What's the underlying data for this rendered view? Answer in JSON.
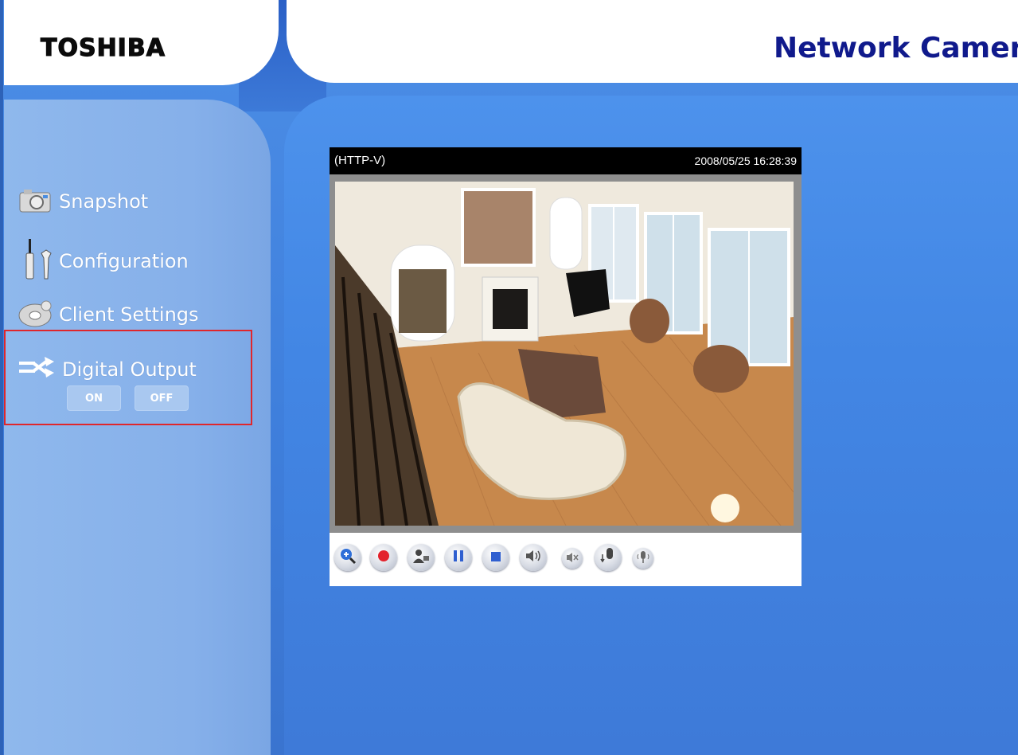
{
  "header": {
    "logo": "TOSHIBA",
    "title": "Network Camera"
  },
  "sidebar": {
    "items": [
      {
        "label": "Snapshot",
        "icon": "camera-icon"
      },
      {
        "label": "Configuration",
        "icon": "tools-icon"
      },
      {
        "label": "Client Settings",
        "icon": "disc-icon"
      },
      {
        "label": "Digital Output",
        "icon": "switch-arrows-icon"
      }
    ],
    "digital_output": {
      "on_label": "ON",
      "off_label": "OFF"
    }
  },
  "viewer": {
    "mode": "(HTTP-V)",
    "timestamp": "2008/05/25 16:28:39",
    "controls": [
      {
        "icon": "zoom-in-icon"
      },
      {
        "icon": "record-icon"
      },
      {
        "icon": "snapshot-person-icon"
      },
      {
        "icon": "pause-icon"
      },
      {
        "icon": "stop-icon"
      },
      {
        "icon": "speaker-icon"
      },
      {
        "icon": "mute-icon"
      },
      {
        "icon": "talk-icon"
      },
      {
        "icon": "microphone-icon"
      }
    ]
  },
  "colors": {
    "title": "#101a8c",
    "highlight_border": "#e0262b",
    "background": "#3f7fdc"
  }
}
